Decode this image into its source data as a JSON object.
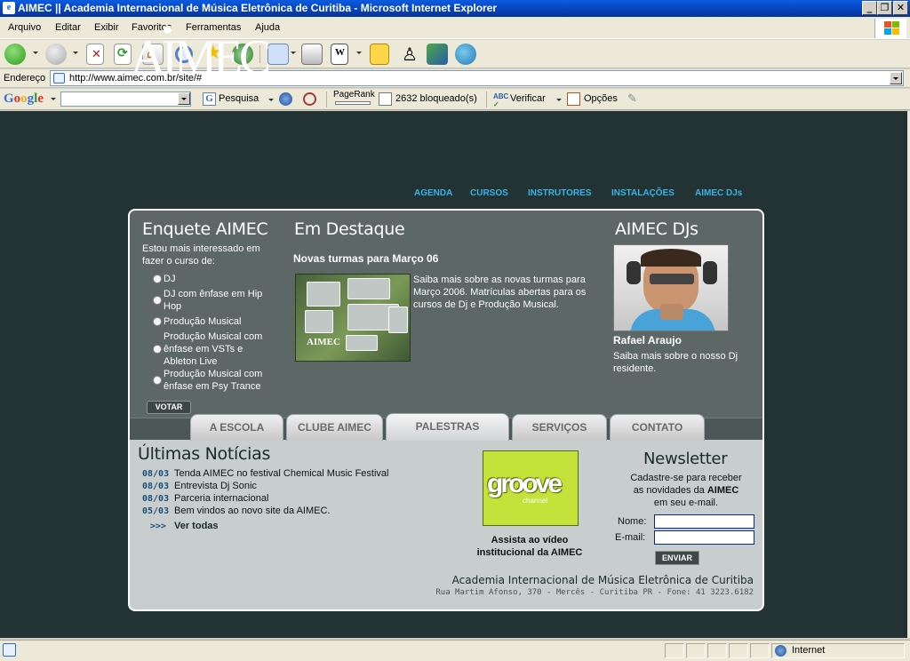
{
  "window": {
    "title": "AIMEC || Academia Internacional de Música Eletrônica de Curitiba - Microsoft Internet Explorer",
    "minimize": "_",
    "maximize": "❐",
    "close": "✕"
  },
  "menu": [
    "Arquivo",
    "Editar",
    "Exibir",
    "Favoritos",
    "Ferramentas",
    "Ajuda"
  ],
  "address": {
    "label": "Endereço",
    "url": "http://www.aimec.com.br/site/#"
  },
  "googlebar": {
    "logo": "Google",
    "search": "Pesquisa",
    "pagerank": "PageRank",
    "blocked": "2632 bloqueado(s)",
    "check": "Verificar",
    "options": "Opções"
  },
  "site": {
    "logo": "AIMEC",
    "nav": [
      "AGENDA",
      "CURSOS",
      "INSTRUTORES",
      "INSTALAÇÕES",
      "AIMEC DJs"
    ],
    "poll": {
      "title": "Enquete AIMEC",
      "question": "Estou mais interessado em fazer o curso de:",
      "options": [
        "DJ",
        "DJ com ênfase em Hip Hop",
        "Produção Musical",
        "Produção Musical com ênfase em VSTs e Ableton Live",
        "Produção Musical com ênfase em Psy Trance"
      ],
      "vote": "VOTAR"
    },
    "featured": {
      "title": "Em Destaque",
      "headline": "Novas turmas para Março 06",
      "body": "Saiba mais sobre as novas turmas para Março 2006. Matrículas abertas para os cursos de Dj e Produção Musical.",
      "image_caption": "AIMEC"
    },
    "djs": {
      "title": "AIMEC DJs",
      "name": "Rafael Araujo",
      "body": "Saiba mais sobre o nosso Dj residente."
    },
    "tabs": [
      "A ESCOLA",
      "CLUBE AIMEC",
      "PALESTRAS",
      "SERVIÇOS",
      "CONTATO"
    ],
    "news": {
      "title": "Últimas Notícias",
      "items": [
        {
          "date": "08/03",
          "text": "Tenda AIMEC no festival Chemical Music Festival"
        },
        {
          "date": "08/03",
          "text": "Entrevista Dj Sonic"
        },
        {
          "date": "08/03",
          "text": "Parceria internacional"
        },
        {
          "date": "05/03",
          "text": "Bem vindos ao novo site da AIMEC."
        }
      ],
      "more_arrows": ">>>",
      "more": "Ver todas"
    },
    "video": {
      "logo_main": "groove",
      "logo_sub": "channel",
      "caption_1": "Assista ao vídeo",
      "caption_2": "institucional da AIMEC"
    },
    "newsletter": {
      "title": "Newsletter",
      "line1": "Cadastre-se para receber",
      "line2_pre": "as novidades da ",
      "line2_bold": "AIMEC",
      "line3": "em seu e-mail.",
      "name_label": "Nome:",
      "email_label": "E-mail:",
      "send": "ENVIAR"
    },
    "footer": {
      "org": "Academia Internacional de Música Eletrônica de Curitiba",
      "address": "Rua Martim Afonso, 370 - Mercês - Curitiba PR - Fone: 41 3223.6182"
    }
  },
  "status": {
    "zone": "Internet"
  }
}
